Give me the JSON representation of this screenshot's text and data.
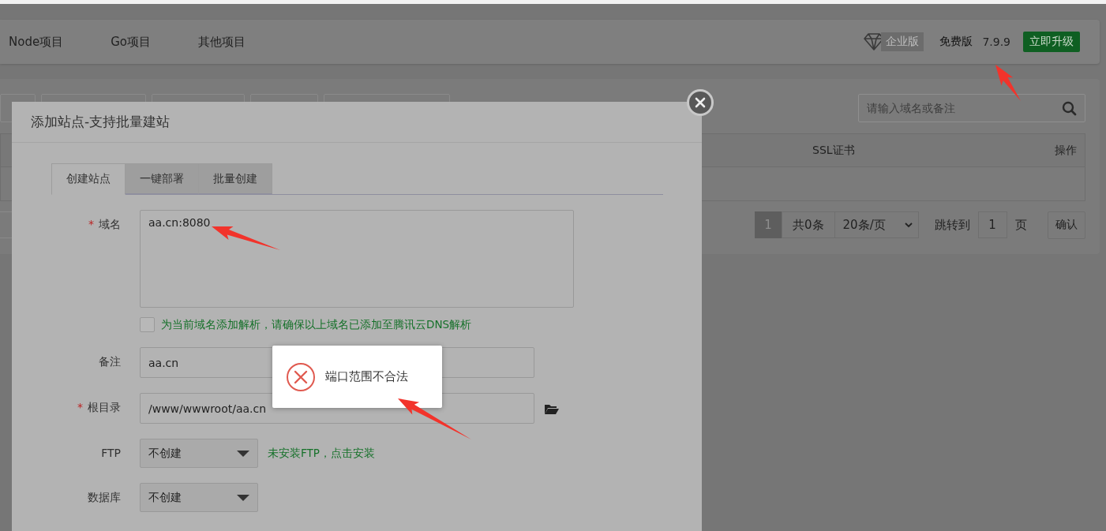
{
  "top_nav": {
    "items": [
      {
        "label": "Node项目"
      },
      {
        "label": "Go项目"
      },
      {
        "label": "其他项目"
      }
    ],
    "edition_badge": "企业版",
    "plan": "免费版",
    "version": "7.9.9",
    "upgrade_button": "立即升级"
  },
  "site_panel": {
    "search": {
      "placeholder": "请输入域名或备注"
    },
    "table": {
      "columns": [
        "SSL证书",
        "操作"
      ]
    },
    "pagination": {
      "current": "1",
      "total": "共0条",
      "page_size": "20条/页",
      "jump_label": "跳转到",
      "jump_value": "1",
      "page_unit": "页",
      "confirm": "确认"
    }
  },
  "dialog": {
    "title": "添加站点-支持批量建站",
    "tabs": [
      {
        "label": "创建站点",
        "selected": true
      },
      {
        "label": "一键部署",
        "selected": false
      },
      {
        "label": "批量创建",
        "selected": false
      }
    ],
    "fields": [
      {
        "kind": "textarea",
        "label": "域名",
        "required_mark": "*",
        "value": "aa.cn:8080"
      },
      {
        "kind": "checkbox",
        "checked": false,
        "label": "为当前域名添加解析，请确保以上域名已添加至腾讯云DNS解析"
      },
      {
        "kind": "input",
        "label": "备注",
        "value": "aa.cn"
      },
      {
        "kind": "path",
        "label": "根目录",
        "required_mark": "*",
        "value": "/www/wwwroot/aa.cn"
      },
      {
        "kind": "select",
        "label": "FTP",
        "value": "不创建",
        "hint": "未安装FTP，点击安装"
      },
      {
        "kind": "select",
        "label": "数据库",
        "value": "不创建"
      }
    ]
  },
  "toast": {
    "kind": "error",
    "message": "端口范围不合法"
  }
}
